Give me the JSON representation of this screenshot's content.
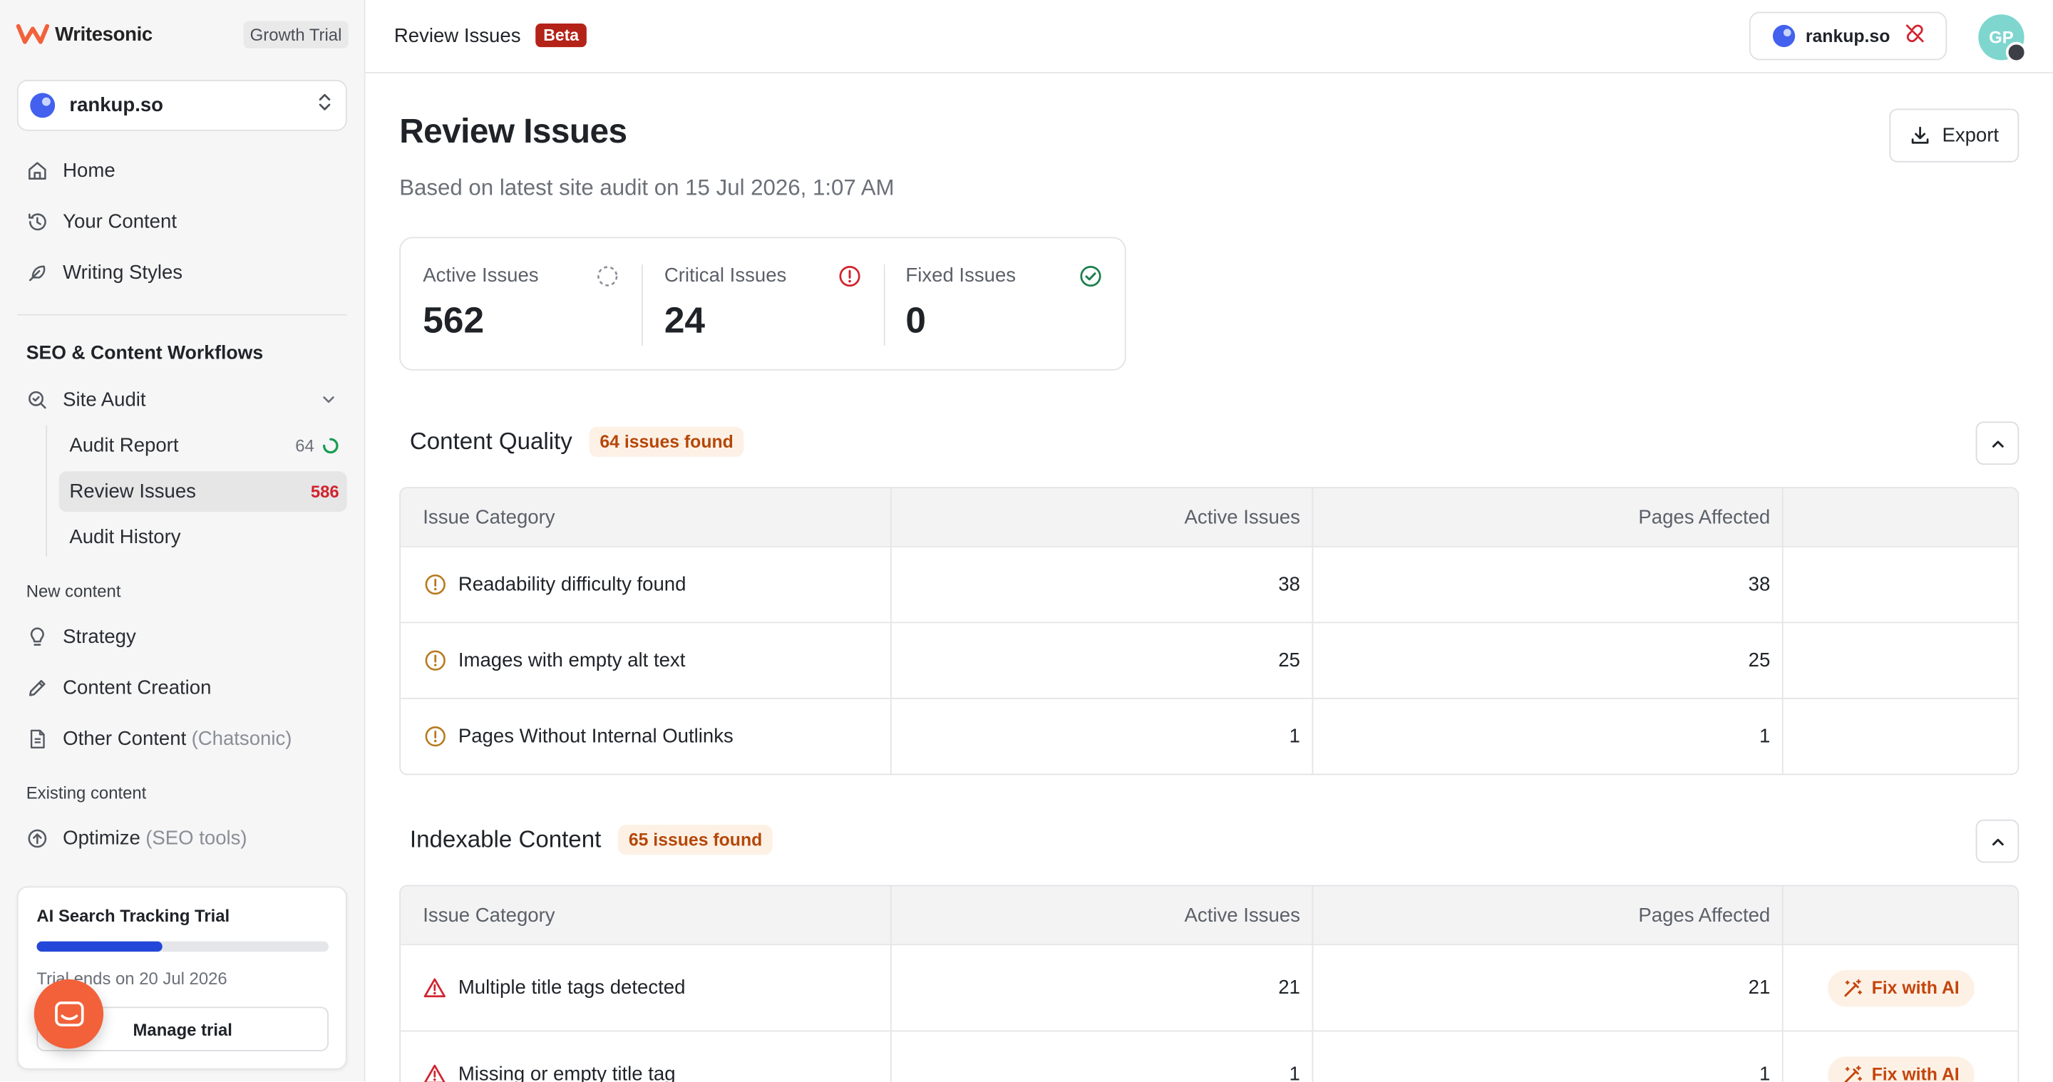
{
  "sidebar": {
    "brand": "Writesonic",
    "plan": "Growth Trial",
    "project": "rankup.so",
    "nav_top": [
      {
        "label": "Home",
        "icon": "home-icon"
      },
      {
        "label": "Your Content",
        "icon": "history-icon"
      },
      {
        "label": "Writing Styles",
        "icon": "feather-icon"
      }
    ],
    "section_title": "SEO & Content Workflows",
    "site_audit": "Site Audit",
    "sub_items": [
      {
        "label": "Audit Report",
        "count": "64"
      },
      {
        "label": "Review Issues",
        "count": "586"
      },
      {
        "label": "Audit History",
        "count": ""
      }
    ],
    "new_content_label": "New content",
    "new_content": [
      {
        "label": "Strategy",
        "suffix": ""
      },
      {
        "label": "Content Creation",
        "suffix": ""
      },
      {
        "label": "Other Content",
        "suffix": "(Chatsonic)"
      }
    ],
    "existing_content_label": "Existing content",
    "existing_content": [
      {
        "label": "Optimize",
        "suffix": "(SEO tools)"
      }
    ],
    "trial": {
      "title": "AI Search Tracking Trial",
      "progress": 0.43,
      "ends": "Trial ends on 20 Jul 2026",
      "button": "Manage trial"
    }
  },
  "topbar": {
    "title": "Review Issues",
    "badge": "Beta",
    "site": "rankup.so",
    "avatar_initials": "GP"
  },
  "main": {
    "title": "Review Issues",
    "subtitle": "Based on latest site audit on 15 Jul 2026, 1:07 AM",
    "export": "Export",
    "stats": [
      {
        "label": "Active Issues",
        "value": "562"
      },
      {
        "label": "Critical Issues",
        "value": "24"
      },
      {
        "label": "Fixed Issues",
        "value": "0"
      }
    ],
    "columns": {
      "category": "Issue Category",
      "active": "Active Issues",
      "pages": "Pages Affected"
    },
    "groups": [
      {
        "title": "Content Quality",
        "badge": "64 issues found",
        "rows": [
          {
            "name": "Readability difficulty found",
            "active": "38",
            "pages": "38",
            "severity": "warning",
            "fix": ""
          },
          {
            "name": "Images with empty alt text",
            "active": "25",
            "pages": "25",
            "severity": "warning",
            "fix": ""
          },
          {
            "name": "Pages Without Internal Outlinks",
            "active": "1",
            "pages": "1",
            "severity": "warning",
            "fix": ""
          }
        ]
      },
      {
        "title": "Indexable Content",
        "badge": "65 issues found",
        "rows": [
          {
            "name": "Multiple title tags detected",
            "active": "21",
            "pages": "21",
            "severity": "critical",
            "fix": "Fix with AI"
          },
          {
            "name": "Missing or empty title tag",
            "active": "1",
            "pages": "1",
            "severity": "critical",
            "fix": "Fix with AI"
          }
        ]
      }
    ]
  },
  "colors": {
    "brand": "#f2613a",
    "critical": "#d1242f",
    "warning": "#b7791f",
    "success": "#1a7f4b",
    "progress": "#2347d9"
  }
}
